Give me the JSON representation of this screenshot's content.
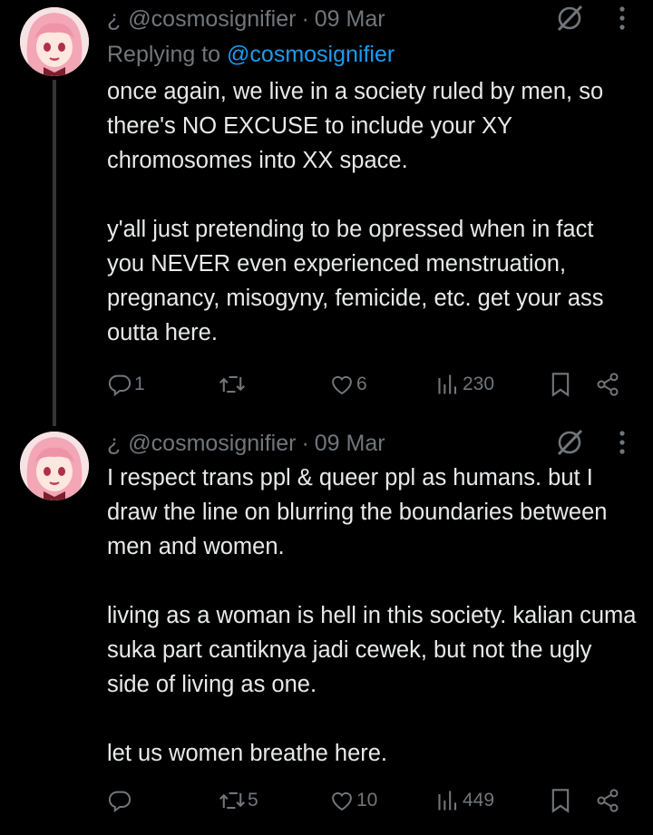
{
  "tweets": [
    {
      "prefix": "¿",
      "handle": "@cosmosignifier",
      "dot": "·",
      "date": "09 Mar",
      "replying_prefix": "Replying to",
      "replying_handle": "@cosmosignifier",
      "paragraphs": [
        "once again, we live in a society ruled by men, so there's NO EXCUSE to include your XY chromosomes into XX space.",
        "y'all just pretending to be opressed when in fact you NEVER even experienced menstruation, pregnancy, misogyny, femicide, etc. get your ass outta here."
      ],
      "replies": "1",
      "retweets": "",
      "likes": "6",
      "views": "230"
    },
    {
      "prefix": "¿",
      "handle": "@cosmosignifier",
      "dot": "·",
      "date": "09 Mar",
      "paragraphs": [
        "I respect trans ppl & queer ppl as humans. but I draw the line on blurring the boundaries between men and women.",
        "living as a woman is hell in this society. kalian cuma suka part cantiknya jadi cewek, but not the ugly side of living as one.",
        "let us women breathe here."
      ],
      "replies": "",
      "retweets": "5",
      "likes": "10",
      "views": "449"
    }
  ],
  "icons": {
    "grok": "grok-icon",
    "more": "more-icon",
    "reply": "reply-icon",
    "retweet": "retweet-icon",
    "like": "like-icon",
    "views": "views-icon",
    "bookmark": "bookmark-icon",
    "share": "share-icon"
  },
  "colors": {
    "background": "#000000",
    "text": "#e7e9ea",
    "muted": "#71767b",
    "link": "#1d9bf0",
    "thread_line": "#333639"
  }
}
